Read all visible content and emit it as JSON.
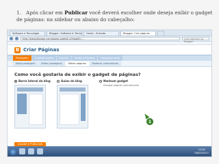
{
  "instruction": {
    "number": "1.",
    "text_before": "Após clicar em ",
    "bold": "Publicar",
    "text_after": " você deverá escolher onde deseja exibir o gadget de páginas: na sidebar ou abaixo do cabeçalho:"
  },
  "browser": {
    "tabs": [
      "Software e Tecnologia",
      "Blogger: Software & Tecnologia",
      "Gmail - Entrada",
      "Blogger: Crie páginas"
    ],
    "url": "http://www.blogger.com/pages-publish.g?blogID=...",
    "search_placeholder": "criar páginas no blogger"
  },
  "app": {
    "logo_letter": "B",
    "title": "Criar Páginas",
    "main_tabs": [
      "Postagem",
      "Configurações",
      "Layout",
      "Saldo e Receita",
      "Visualizar blog"
    ],
    "active_main_tab": 0,
    "sub_tabs": [
      "Nova postagem",
      "Editar postagens",
      "Editar páginas",
      "Moderar comentários"
    ],
    "active_sub_tab": 2
  },
  "publish": {
    "question": "Como você gostaria de exibir o gadget de páginas?",
    "options": [
      {
        "label": "Barra lateral do blog",
        "selected": true
      },
      {
        "label": "Guias do blog",
        "selected": false
      },
      {
        "label": "Nenhum gadget",
        "selected": false,
        "hint": "Divulgar páginas manualmente"
      }
    ],
    "callout": "1",
    "save_label": "SALVAR E PUBLICAR"
  },
  "taskbar": {
    "time": "12:00",
    "date": "06/05/2011"
  },
  "colors": {
    "accent": "#f57d00",
    "nav_blue": "#2b5f8c",
    "callout_green": "#3f8a2e"
  }
}
